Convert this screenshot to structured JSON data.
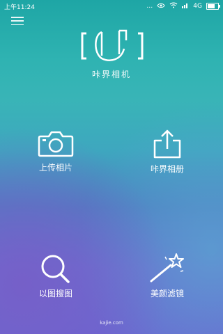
{
  "status_bar": {
    "time": "上午11:24",
    "network": "4G",
    "battery_level": 0.7
  },
  "menu": {
    "icon": "hamburger-menu-icon"
  },
  "app": {
    "title": "咔界相机",
    "logo_icon": "camera-frame-logo"
  },
  "features": [
    {
      "label": "上传相片",
      "icon": "camera-icon"
    },
    {
      "label": "咔界相册",
      "icon": "share-upload-icon"
    },
    {
      "label": "以图搜图",
      "icon": "search-icon"
    },
    {
      "label": "美颜滤镜",
      "icon": "magic-wand-icon"
    }
  ],
  "footer": {
    "text": "kajie.com"
  }
}
